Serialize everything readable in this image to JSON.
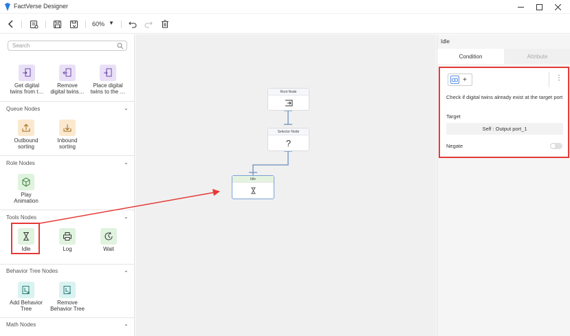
{
  "window": {
    "title": "FactVerse Designer",
    "min_icon": "minimize-icon",
    "max_icon": "maximize-icon",
    "close_icon": "close-icon"
  },
  "toolbar": {
    "zoom": "60%"
  },
  "search": {
    "placeholder": "Search"
  },
  "top_nodes": [
    {
      "label": "Get digital\ntwins from t…"
    },
    {
      "label": "Remove\ndigital twins…"
    },
    {
      "label": "Place digital\ntwins to the …"
    }
  ],
  "sections": {
    "queue": {
      "title": "Queue Nodes",
      "items": [
        {
          "label": "Outbound\nsorting"
        },
        {
          "label": "Inbound\nsorting"
        }
      ]
    },
    "role": {
      "title": "Role Nodes",
      "items": [
        {
          "label": "Play\nAnimation"
        }
      ]
    },
    "tools": {
      "title": "Tools Nodes",
      "items": [
        {
          "label": "Idle"
        },
        {
          "label": "Log"
        },
        {
          "label": "Wait"
        }
      ]
    },
    "behavior": {
      "title": "Behavior Tree Nodes",
      "items": [
        {
          "label": "Add Behavior\nTree"
        },
        {
          "label": "Remove\nBehavior Tree"
        }
      ]
    },
    "math": {
      "title": "Math Nodes"
    }
  },
  "canvas": {
    "root": {
      "title": "Root Node"
    },
    "selector": {
      "title": "Selector Node",
      "symbol": "?"
    },
    "idle": {
      "title": "Idle"
    }
  },
  "right_panel": {
    "title": "Idle",
    "tabs": {
      "condition": "Condition",
      "attribute": "Attribute"
    },
    "plus": "+",
    "kebab": "⋮",
    "description": "Check if digital twins already exist at the target port",
    "target_label": "Target",
    "target_value": "Self : Output port_1",
    "negate_label": "Negate"
  },
  "colors": {
    "highlight": "#e53935",
    "accent": "#5b8fe8"
  }
}
